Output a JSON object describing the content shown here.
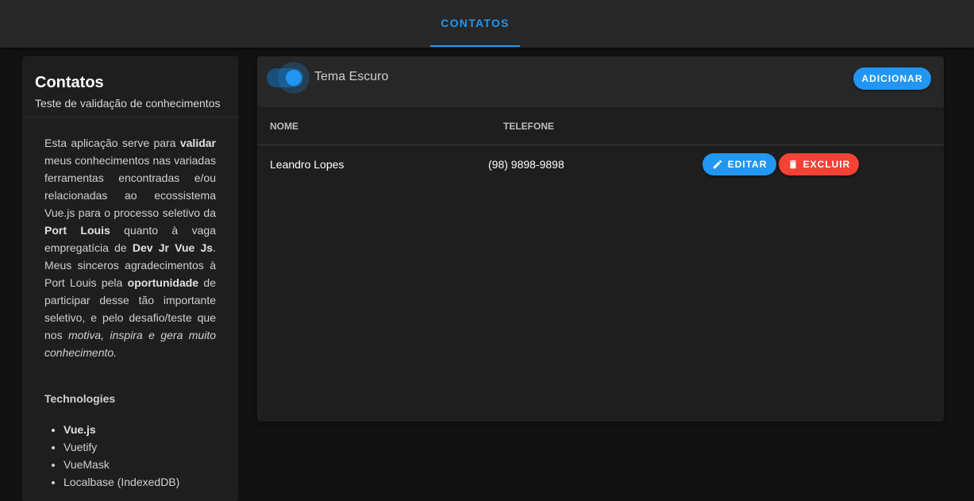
{
  "header": {
    "tab_label": "CONTATOS"
  },
  "sidebar": {
    "title": "Contatos",
    "subtitle": "Teste de validação de conhecimentos",
    "description": {
      "p1": "Esta aplicação serve para ",
      "b1": "validar",
      "p2": " meus conhecimentos nas variadas ferramentas encontradas e/ou relacionadas ao ecossistema Vue.js para o processo seletivo da ",
      "b2": "Port Louis",
      "p3": " quanto à vaga empregatícia de ",
      "b3": "Dev Jr Vue Js",
      "p4": ". Meus sinceros agradecimentos à Port Louis pela ",
      "b4": "oportunidade",
      "p5": " de participar desse tão importante seletivo, e pelo desafio/teste que nos ",
      "i1": "motiva, inspira e gera muito conhecimento."
    },
    "technologies_title": "Technologies",
    "technologies": [
      "Vue.js",
      "Vuetify",
      "VueMask",
      "Localbase (IndexedDB)"
    ]
  },
  "toolbar": {
    "theme_toggle_label": "Tema Escuro",
    "theme_toggle_on": true,
    "add_button": "ADICIONAR"
  },
  "table": {
    "headers": {
      "name": "NOME",
      "phone": "TELEFONE"
    },
    "rows": [
      {
        "name": "Leandro Lopes",
        "phone": "(98) 9898-9898",
        "edit_label": "EDITAR",
        "delete_label": "EXCLUIR"
      }
    ]
  },
  "colors": {
    "primary": "#2196f3",
    "error": "#f44336",
    "background": "#121212",
    "surface": "#1e1e1e"
  },
  "icons": {
    "edit": "pencil-icon",
    "delete": "trash-icon"
  }
}
